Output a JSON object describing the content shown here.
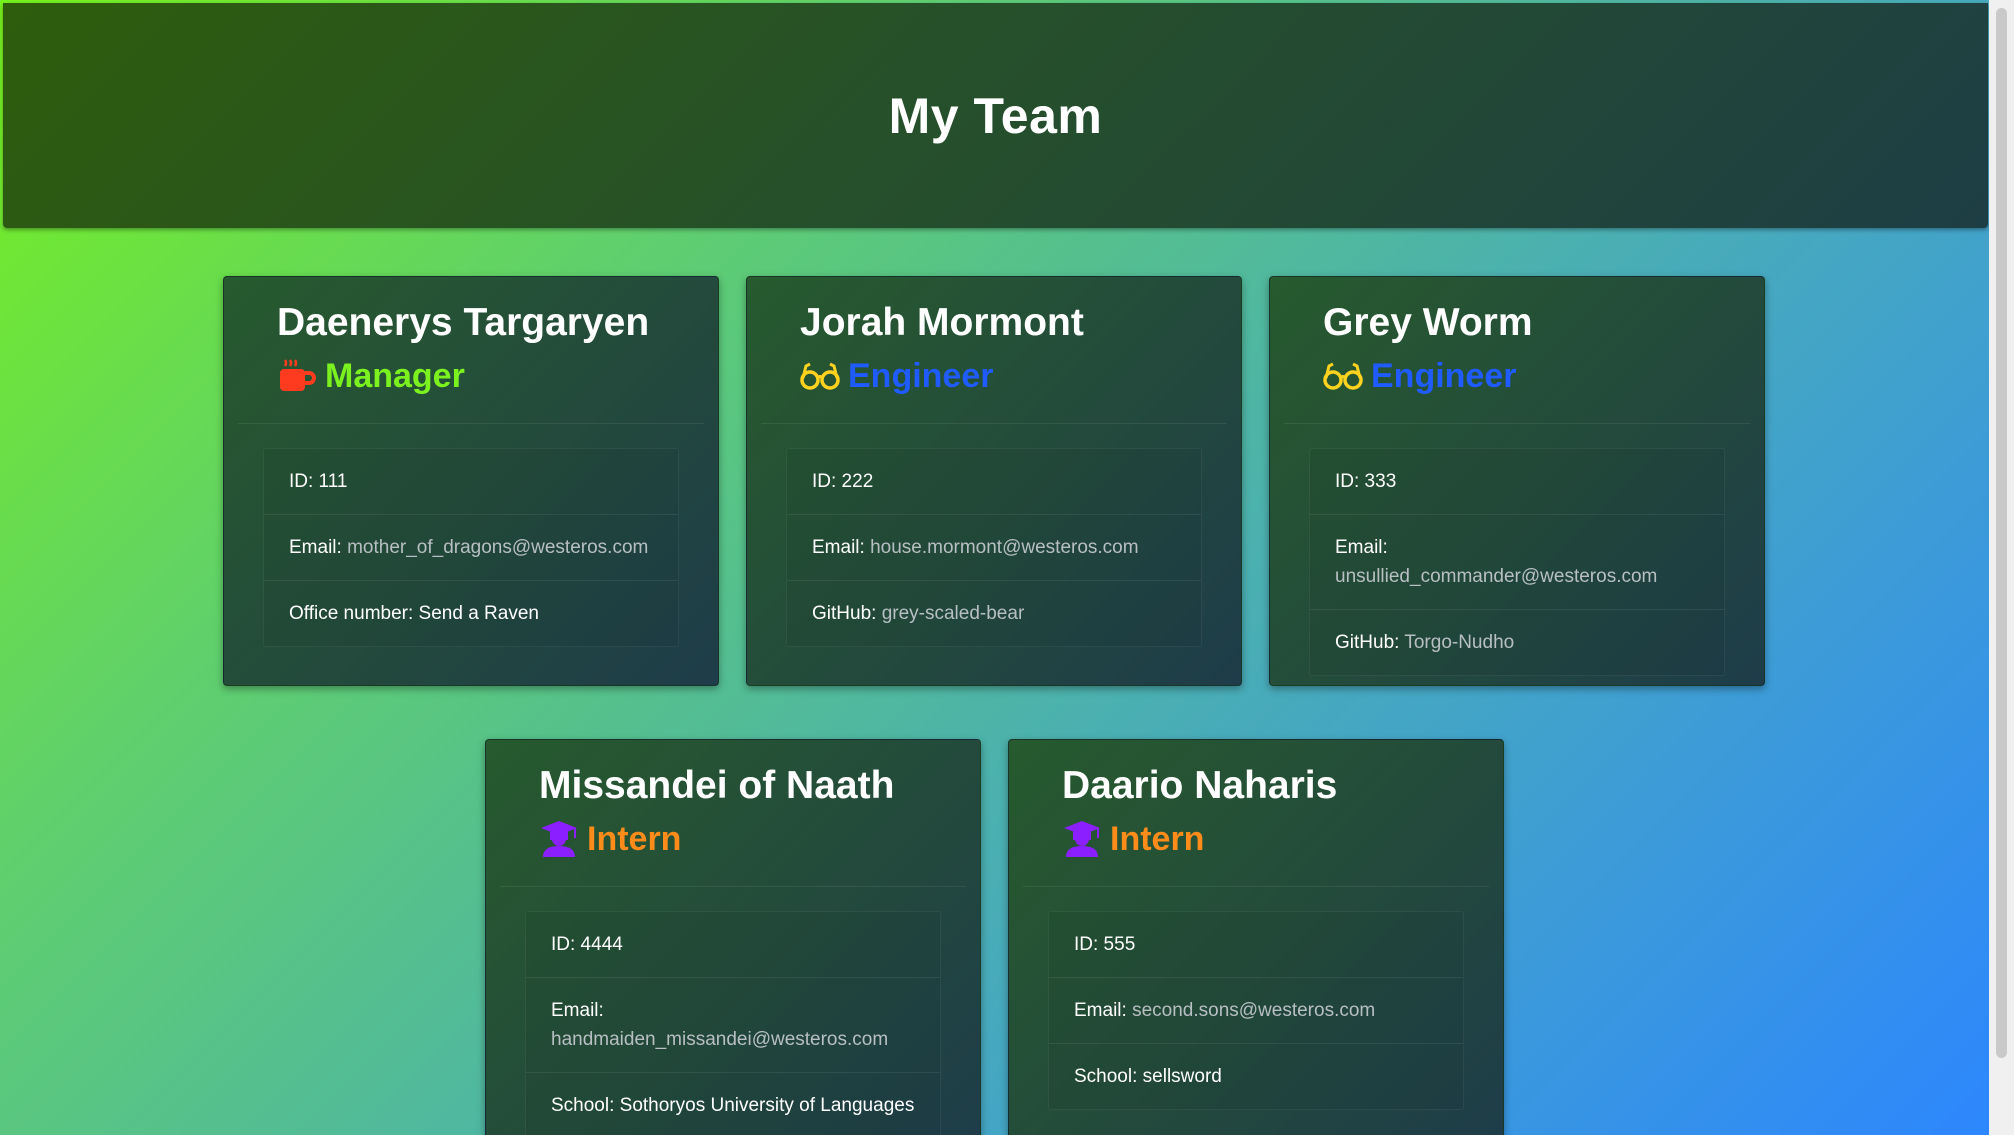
{
  "header": {
    "title": "My Team"
  },
  "colors": {
    "manager": "#7bf21f",
    "engineer": "#1f5bff",
    "intern": "#ff8c1a",
    "manager_icon": "#ff3b1f",
    "engineer_icon": "#ffd21f",
    "intern_icon": "#8b1fff"
  },
  "cards": [
    {
      "name": "Daenerys Targaryen",
      "role": "Manager",
      "icon": "mug-icon",
      "id_text": "ID: 111",
      "email_label": "Email:",
      "email": "mother_of_dragons@westeros.com",
      "extra_label": "Office number:",
      "extra_value": "Send a Raven"
    },
    {
      "name": "Jorah Mormont",
      "role": "Engineer",
      "icon": "glasses-icon",
      "id_text": "ID: 222",
      "email_label": "Email:",
      "email": "house.mormont@westeros.com",
      "extra_label": "GitHub:",
      "extra_value": "grey-scaled-bear"
    },
    {
      "name": "Grey Worm",
      "role": "Engineer",
      "icon": "glasses-icon",
      "id_text": "ID: 333",
      "email_label": "Email:",
      "email": "unsullied_commander@westeros.com",
      "extra_label": "GitHub:",
      "extra_value": "Torgo-Nudho"
    },
    {
      "name": "Missandei of Naath",
      "role": "Intern",
      "icon": "graduate-icon",
      "id_text": "ID: 4444",
      "email_label": "Email:",
      "email": "handmaiden_missandei@westeros.com",
      "extra_label": "School:",
      "extra_value": "Sothoryos University of Languages"
    },
    {
      "name": "Daario Naharis",
      "role": "Intern",
      "icon": "graduate-icon",
      "id_text": "ID: 555",
      "email_label": "Email:",
      "email": "second.sons@westeros.com",
      "extra_label": "School:",
      "extra_value": "sellsword"
    }
  ]
}
